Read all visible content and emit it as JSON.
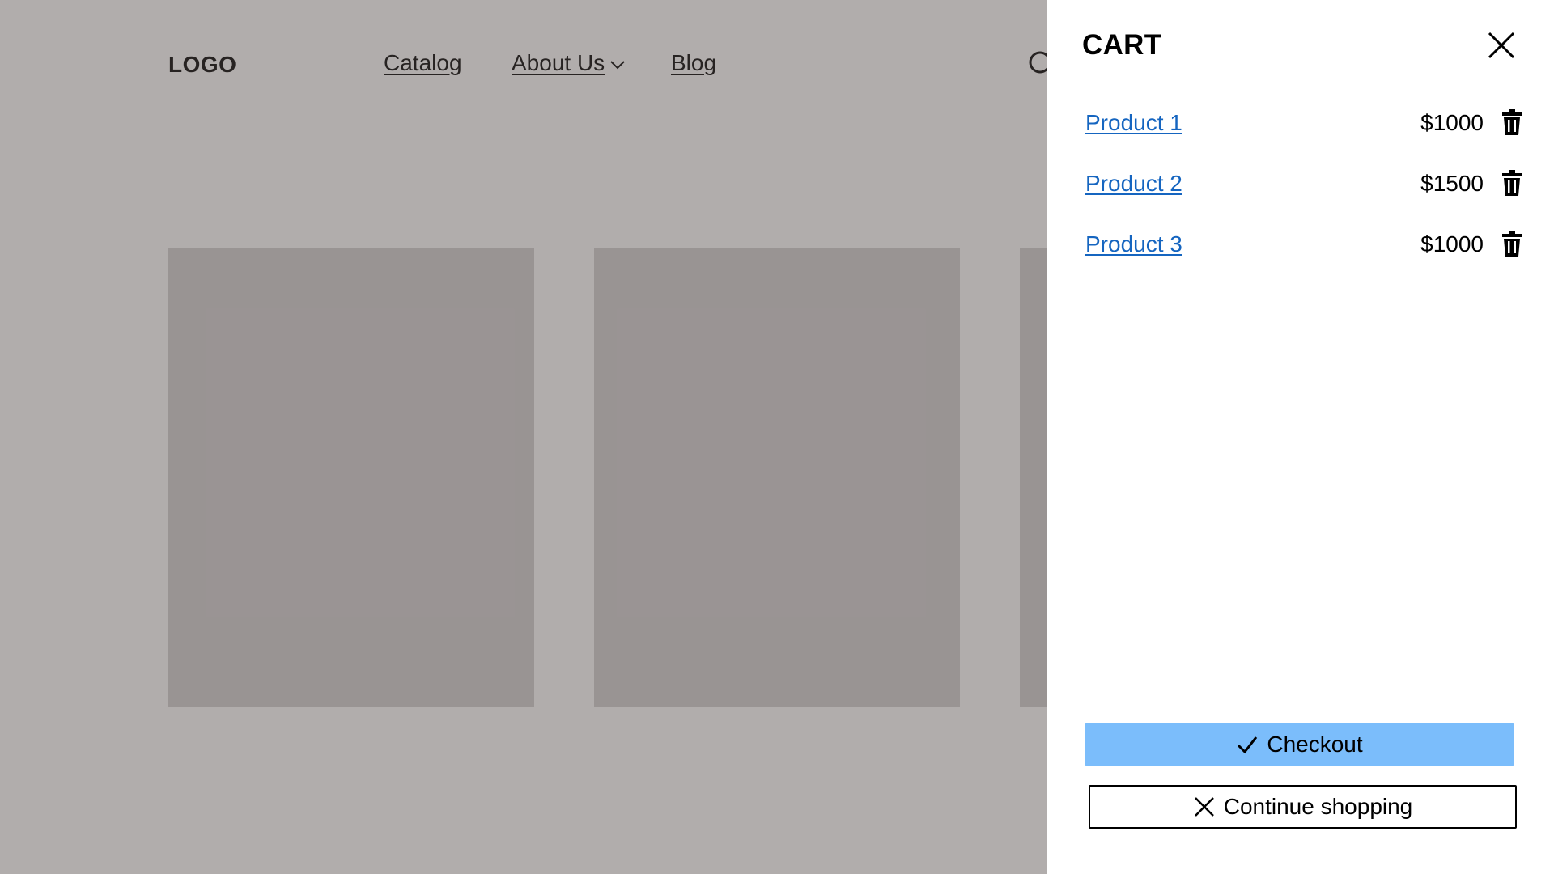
{
  "header": {
    "logo": "LOGO",
    "nav": {
      "catalog": "Catalog",
      "about": "About Us",
      "blog": "Blog"
    },
    "icons": {
      "search": "search-icon",
      "about_dropdown": "chevron-down-icon"
    }
  },
  "cart": {
    "title": "CART",
    "close_icon": "close-icon",
    "items": [
      {
        "name": "Product 1",
        "price": "$1000",
        "remove_icon": "trash-icon"
      },
      {
        "name": "Product 2",
        "price": "$1500",
        "remove_icon": "trash-icon"
      },
      {
        "name": "Product 3",
        "price": "$1000",
        "remove_icon": "trash-icon"
      }
    ],
    "checkout_label": "Checkout",
    "checkout_icon": "check-icon",
    "continue_label": "Continue shopping",
    "continue_icon": "close-icon"
  },
  "colors": {
    "link": "#1565c0",
    "checkout_bg": "#7bbdfb",
    "overlay": "rgba(60,50,48,0.40)",
    "card_placeholder": "#d8d6d6"
  }
}
